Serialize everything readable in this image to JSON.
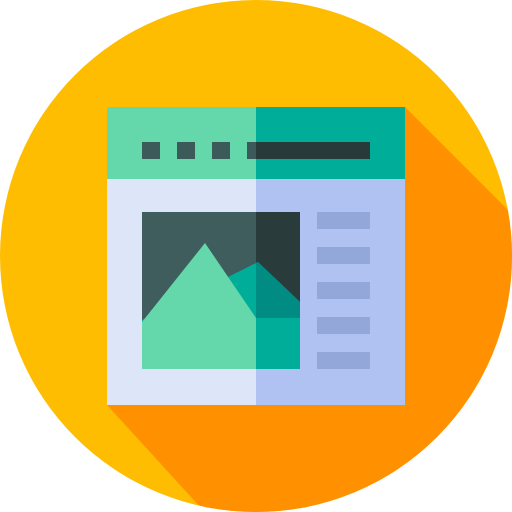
{
  "icon": {
    "name": "web-page-image-layout-icon",
    "colors": {
      "circle_bg": "#FEBD00",
      "long_shadow": "#FF9100",
      "header_left": "#64D8AA",
      "header_right": "#00AD98",
      "header_dots": "#3D5A5A",
      "header_bar": "#283A3A",
      "body_left": "#DCE6F8",
      "body_right": "#AFC2F2",
      "image_frame_left": "#3F5D5D",
      "image_frame_right": "#293B3B",
      "mountain_light": "#64D8AA",
      "mountain_teal": "#00AD98",
      "mountain_dark_teal": "#008C82",
      "text_lines": "#93A8D8"
    }
  }
}
